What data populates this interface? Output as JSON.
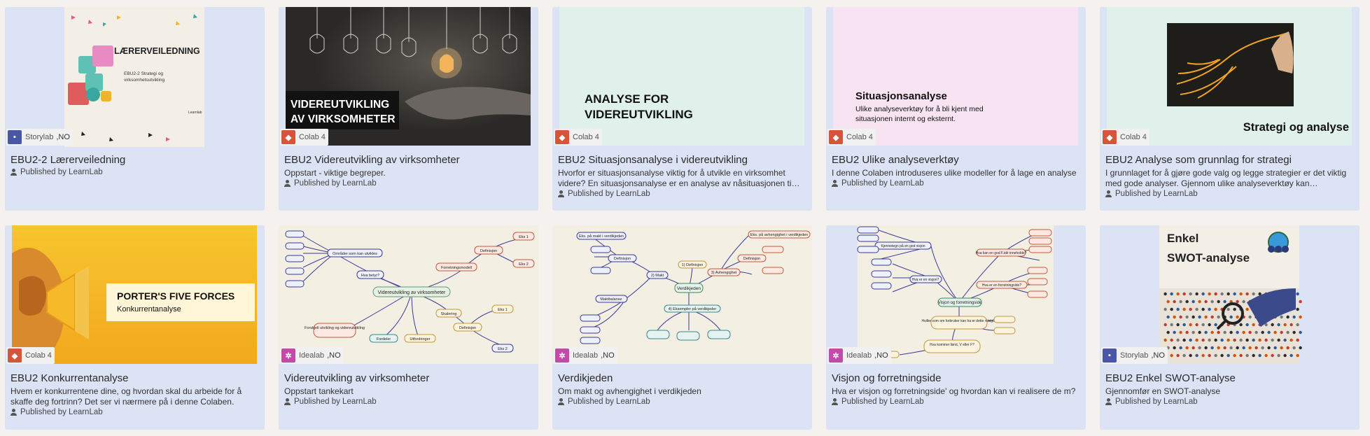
{
  "published_label": "Published by LearnLab",
  "cards": [
    {
      "title": "EBU2-2 Lærerveiledning",
      "desc": "",
      "tag": "Storylab",
      "lang": ",NO",
      "thumb": {
        "heading": "LÆRERVEILEDNING",
        "sub1": "EBU2-2 Strategi og",
        "sub2": "virksomhetsutvikling",
        "brand": "Learnlab"
      }
    },
    {
      "title": "EBU2 Videreutvikling av virksomheter",
      "desc": "Oppstart - viktige begreper.",
      "tag": "Colab 4",
      "lang": "",
      "thumb": {
        "line1": "VIDEREUTVIKLING",
        "line2": "AV VIRKSOMHETER"
      }
    },
    {
      "title": "EBU2 Situasjonsanalyse i videreutvikling",
      "desc": "Hvorfor er situasjonsanalyse viktig for å utvikle en virksomhet videre? En situasjonsanalyse er en analyse av nåsituasjonen ti…",
      "tag": "Colab 4",
      "lang": "",
      "thumb": {
        "line1": "ANALYSE FOR",
        "line2": "VIDEREUTVIKLING"
      }
    },
    {
      "title": "EBU2 Ulike analyseverktøy",
      "desc": "I denne Colaben introduseres ulike modeller for å lage en analyse",
      "tag": "Colab 4",
      "lang": "",
      "thumb": {
        "heading": "Situasjonsanalyse",
        "sub1": "Ulike analyseverktøy for å bli kjent med",
        "sub2": "situasjonen internt og eksternt."
      }
    },
    {
      "title": "EBU2 Analyse som grunnlag for strategi",
      "desc": "I grunnlaget for å gjøre gode valg og legge strategier er det viktig med gode analyser. Gjennom ulike analyseverktøy kan…",
      "tag": "Colab 4",
      "lang": "",
      "thumb": {
        "heading": "Strategi og analyse"
      }
    },
    {
      "title": "EBU2 Konkurrentanalyse",
      "desc": "Hvem er konkurrentene dine, og hvordan skal du arbeide for å skaffe deg fortrinn? Det ser vi nærmere på i denne Colaben.",
      "tag": "Colab 4",
      "lang": "",
      "thumb": {
        "heading": "PORTER'S FIVE FORCES",
        "sub1": "Konkurrentanalyse"
      }
    },
    {
      "title": "Videreutvikling av virksomheter",
      "desc": "Oppstart tankekart",
      "tag": "Idealab",
      "lang": ",NO",
      "thumb": {
        "center": "Videreutvikling av virksomheter",
        "n1": "Områder som kan utvikles",
        "n2": "Hva betyr?",
        "n3": "Forretningsmodell",
        "n4": "Definisjon",
        "n5": "Eks 1",
        "n6": "Eks 2",
        "n7": "Forskjell utvikling og videreutvikling",
        "n8": "Fordeler",
        "n9": "Utfordringer",
        "n10": "Skalering",
        "n11": "Definisjon",
        "n12": "Eks 1",
        "n13": "Eks 2"
      }
    },
    {
      "title": "Verdikjeden",
      "desc": "Om makt og avhengighet i verdikjeden",
      "tag": "Idealab",
      "lang": ",NO",
      "thumb": {
        "center": "Verdikjeden",
        "n1": "Eks. på makt i verdikjeden",
        "n2": "Definisjon",
        "n3": "2) Makt",
        "n4": "1) Definisjon",
        "n5": "3) Avhengighet",
        "n6": "Eks. på avhengighet i verdikjeden",
        "n7": "Definisjon",
        "n8": "4) Eksempler på verdikjeder",
        "n9": "Maktbalanse"
      }
    },
    {
      "title": "Visjon og forretningside",
      "desc": "Hva er visjon og forretningside' og hvordan kan vi realisere de m?",
      "tag": "Idealab",
      "lang": ",NO",
      "thumb": {
        "center": "Visjon og forretningside",
        "n1": "Kjennetegn på en god visjon",
        "n2": "Hva er en visjon?",
        "n3": "Hva kan en god F.idé inneholde?",
        "n4": "Hva er en forretningside?",
        "n5": "Hvilke som om forbruker kan ha er dette rt bigd?",
        "n6": "Hva kommer først, V eller F?"
      }
    },
    {
      "title": "EBU2 Enkel SWOT-analyse",
      "desc": "Gjennomfør en SWOT-analyse",
      "tag": "Storylab",
      "lang": ",NO",
      "thumb": {
        "line1": "Enkel",
        "line2": "SWOT-analyse"
      }
    }
  ]
}
